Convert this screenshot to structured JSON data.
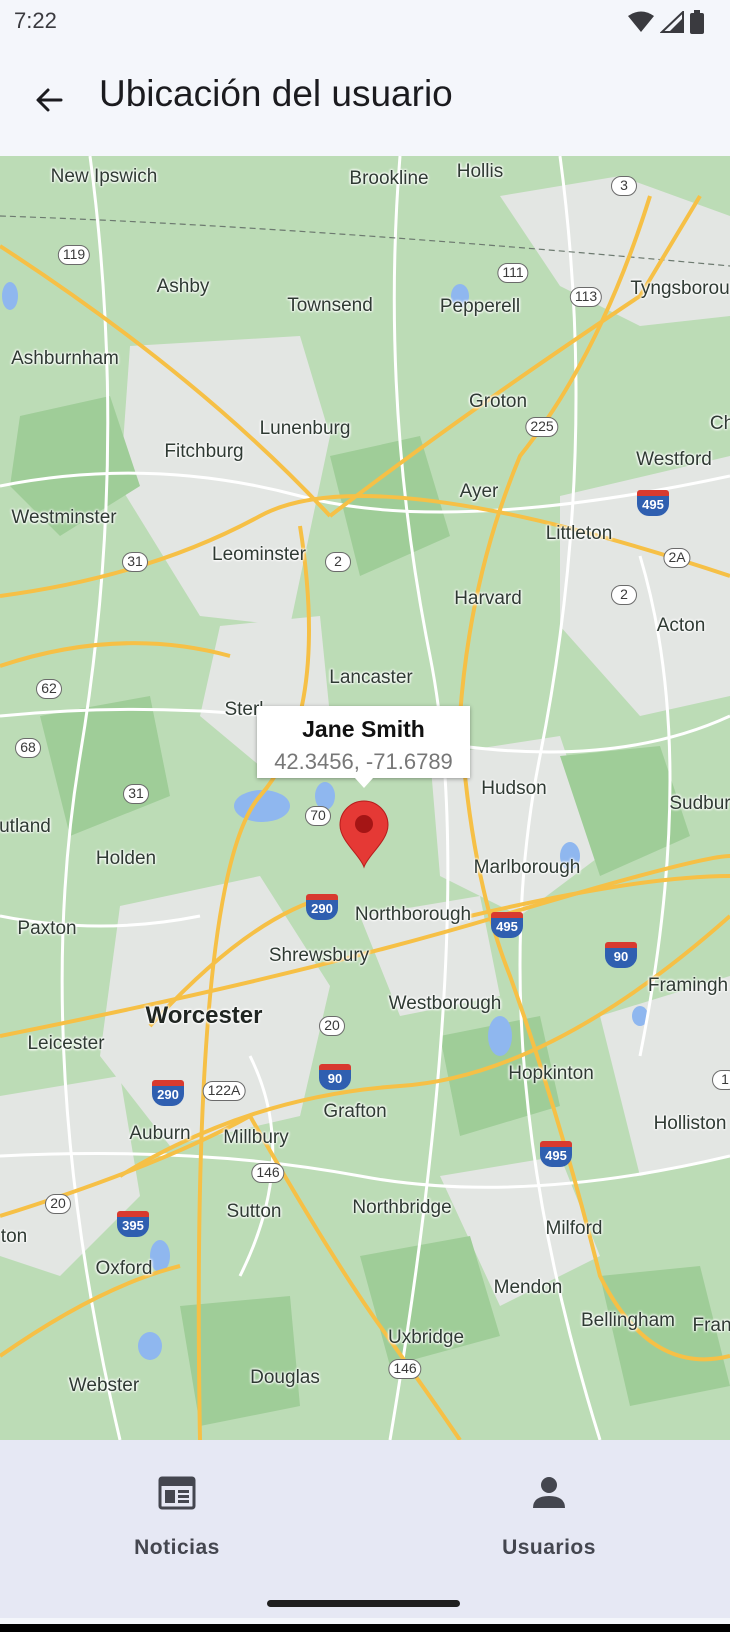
{
  "status_bar": {
    "time": "7:22"
  },
  "app_bar": {
    "title": "Ubicación del usuario",
    "back_icon": "arrow-back-icon"
  },
  "map": {
    "places": [
      {
        "name": "New Ipswich"
      },
      {
        "name": "Brookline"
      },
      {
        "name": "Hollis"
      },
      {
        "name": "Ashby"
      },
      {
        "name": "Townsend"
      },
      {
        "name": "Pepperell"
      },
      {
        "name": "Tyngsborou"
      },
      {
        "name": "Ashburnham"
      },
      {
        "name": "Groton"
      },
      {
        "name": "Lunenburg"
      },
      {
        "name": "Fitchburg"
      },
      {
        "name": "Westford"
      },
      {
        "name": "Ch"
      },
      {
        "name": "Ayer"
      },
      {
        "name": "Westminster"
      },
      {
        "name": "Leominster"
      },
      {
        "name": "Littleton"
      },
      {
        "name": "Harvard"
      },
      {
        "name": "Acton"
      },
      {
        "name": "Lancaster"
      },
      {
        "name": "Sterl"
      },
      {
        "name": "Hudson"
      },
      {
        "name": "Sudbur"
      },
      {
        "name": "utland"
      },
      {
        "name": "Holden"
      },
      {
        "name": "Marlborough"
      },
      {
        "name": "Northborough"
      },
      {
        "name": "Paxton"
      },
      {
        "name": "Shrewsbury"
      },
      {
        "name": "Framingh"
      },
      {
        "name": "Worcester",
        "big": true
      },
      {
        "name": "Westborough"
      },
      {
        "name": "Leicester"
      },
      {
        "name": "Hopkinton"
      },
      {
        "name": "Grafton"
      },
      {
        "name": "Auburn"
      },
      {
        "name": "Millbury"
      },
      {
        "name": "Holliston"
      },
      {
        "name": "Sutton"
      },
      {
        "name": "Northbridge"
      },
      {
        "name": "ton"
      },
      {
        "name": "Milford"
      },
      {
        "name": "Oxford"
      },
      {
        "name": "Mendon"
      },
      {
        "name": "Bellingham"
      },
      {
        "name": "Fran"
      },
      {
        "name": "Uxbridge"
      },
      {
        "name": "Webster"
      },
      {
        "name": "Douglas"
      }
    ],
    "route_shields": [
      {
        "label": "119"
      },
      {
        "label": "3"
      },
      {
        "label": "111"
      },
      {
        "label": "113"
      },
      {
        "label": "225"
      },
      {
        "label": "31"
      },
      {
        "label": "2"
      },
      {
        "label": "2A"
      },
      {
        "label": "2"
      },
      {
        "label": "62"
      },
      {
        "label": "68"
      },
      {
        "label": "31"
      },
      {
        "label": "70"
      },
      {
        "label": "20"
      },
      {
        "label": "122A"
      },
      {
        "label": "146"
      },
      {
        "label": "20"
      },
      {
        "label": "146"
      },
      {
        "label": "1"
      }
    ],
    "interstate_shields": [
      {
        "label": "495"
      },
      {
        "label": "290"
      },
      {
        "label": "495"
      },
      {
        "label": "90"
      },
      {
        "label": "290"
      },
      {
        "label": "90"
      },
      {
        "label": "495"
      },
      {
        "label": "395"
      }
    ],
    "marker": {
      "name": "Jane Smith",
      "coordinates": "42.3456, -71.6789",
      "color": "#e53935",
      "icon": "map-pin-icon"
    }
  },
  "bottom_nav": {
    "items": [
      {
        "label": "Noticias",
        "icon": "newspaper-icon"
      },
      {
        "label": "Usuarios",
        "icon": "person-icon"
      }
    ]
  },
  "colors": {
    "accent": "#1b1b1f",
    "nav_background": "#e6e8f4",
    "marker": "#e53935"
  }
}
